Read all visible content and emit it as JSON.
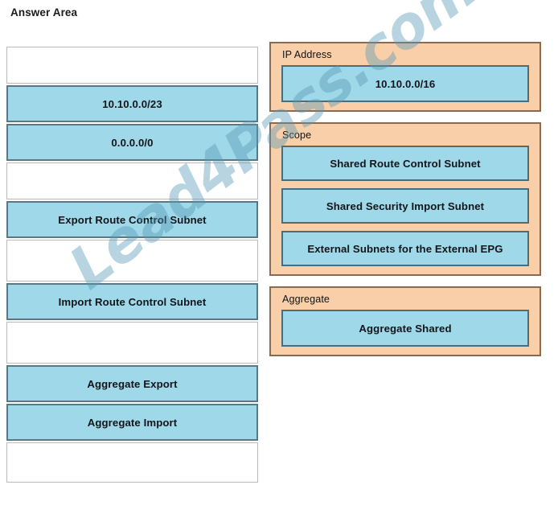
{
  "page": {
    "title": "Answer Area",
    "watermark": "Lead4Pass.com",
    "colors": {
      "chip_fill": "#9fd8e8",
      "chip_border": "#5c7782",
      "group_fill": "#f9cfa9",
      "group_border": "#8a6a51",
      "slot_border": "#b9bcbe",
      "text": "#12161a",
      "watermark": "#5698b5"
    }
  },
  "answer_column": {
    "name": "answer-area-drop-column",
    "slots": [
      {
        "kind": "empty",
        "label": "",
        "size": "short"
      },
      {
        "kind": "chip",
        "label": "10.10.0.0/23"
      },
      {
        "kind": "chip",
        "label": "0.0.0.0/0"
      },
      {
        "kind": "empty",
        "label": "",
        "size": "short"
      },
      {
        "kind": "chip",
        "label": "Export Route Control Subnet"
      },
      {
        "kind": "empty",
        "label": "",
        "size": "tall"
      },
      {
        "kind": "chip",
        "label": "Import Route Control Subnet"
      },
      {
        "kind": "empty",
        "label": "",
        "size": "tall"
      },
      {
        "kind": "chip",
        "label": "Aggregate Export"
      },
      {
        "kind": "chip",
        "label": "Aggregate Import"
      },
      {
        "kind": "empty",
        "label": "",
        "size": "mid"
      }
    ]
  },
  "source_column": {
    "groups": [
      {
        "id": "ip",
        "label": "IP Address",
        "items": [
          "10.10.0.0/16"
        ]
      },
      {
        "id": "scope",
        "label": "Scope",
        "items": [
          "Shared Route Control Subnet",
          "Shared Security Import Subnet",
          "External Subnets for the External EPG"
        ]
      },
      {
        "id": "aggregate",
        "label": "Aggregate",
        "items": [
          "Aggregate Shared"
        ]
      }
    ]
  }
}
